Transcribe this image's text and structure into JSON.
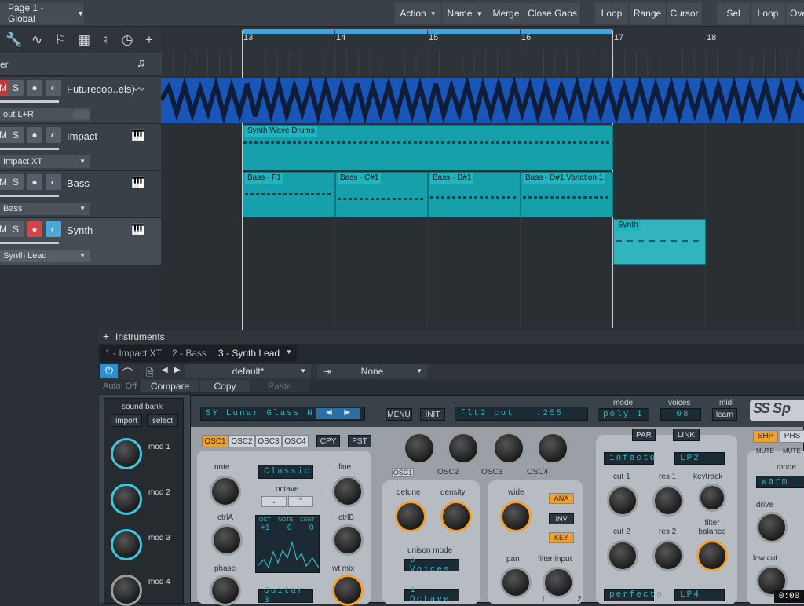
{
  "toolbar": {
    "page": "Page 1 - Global",
    "action": "Action",
    "name": "Name",
    "merge": "Merge",
    "close_gaps": "Close Gaps",
    "loop": "Loop",
    "range": "Range",
    "cursor": "Cursor",
    "sel": "Sel",
    "loop2": "Loop",
    "ove": "Ove"
  },
  "ruler": {
    "marks": [
      "13",
      "14",
      "15",
      "16",
      "17",
      "18"
    ]
  },
  "tracks": [
    {
      "label": "Futurecop..els)",
      "output": "out L+R",
      "m": "M",
      "s": "S"
    },
    {
      "label": "Impact",
      "output": "Impact XT",
      "m": "M",
      "s": "S"
    },
    {
      "label": "Bass",
      "output": "Bass",
      "m": "M",
      "s": "S"
    },
    {
      "label": "Synth",
      "output": "Synth Lead",
      "m": "M",
      "s": "S"
    }
  ],
  "header_label": "er",
  "clips": {
    "drums": "Synth Wave Drums",
    "bass1": "Bass - F1",
    "bass2": "Bass - C#1",
    "bass3": "Bass - D#1",
    "bass4": "Bass - D#1 Variation 1",
    "synth": "Synth"
  },
  "instruments": {
    "title": "Instruments",
    "tabs": [
      "1 - Impact XT",
      "2 - Bass",
      "3 - Synth Lead"
    ],
    "preset": "default*",
    "sidechain": "None",
    "auto": "Auto: Off",
    "compare": "Compare",
    "copy": "Copy",
    "paste": "Paste"
  },
  "synth": {
    "sound_bank": "sound bank",
    "import": "import",
    "select": "select",
    "mods": [
      "mod 1",
      "mod 2",
      "mod 3",
      "mod 4"
    ],
    "patch": "SY Lunar Glass N",
    "menu": "MENU",
    "init": "INIT",
    "param": "flt2 cut",
    "param_val": ":255",
    "mode_lbl": "mode",
    "mode": "poly 1",
    "voices_lbl": "voices",
    "voices": "08",
    "midi_lbl": "midi",
    "learn": "learn",
    "logo": "Sp",
    "osc_tabs": [
      "OSC1",
      "OSC2",
      "OSC3",
      "OSC4"
    ],
    "cpy": "CPY",
    "pst": "PST",
    "osc_sel": [
      "OSC1",
      "OSC2",
      "OSC3",
      "OSC4"
    ],
    "note": "note",
    "fine": "fine",
    "octave": "octave",
    "classic": "Classic",
    "ctrla": "ctrlA",
    "ctrlb": "ctrlB",
    "phase": "phase",
    "wtmix": "wt mix",
    "oct": "OCT",
    "note2": "NOTE",
    "cent": "CENT",
    "oct_v": "+1",
    "note_v": "0",
    "cent_v": "0",
    "guitar": "Guitar 3",
    "detune": "detune",
    "density": "density",
    "unison": "unison mode",
    "voices6": "6 Voices",
    "octave1": "1 Octave",
    "wide": "wide",
    "ana": "ANA",
    "inv": "INV",
    "key": "KEY",
    "pan": "pan",
    "filter_input": "filter input",
    "par": "PAR",
    "link": "LINK",
    "f1": "infecto",
    "f2": "LP2",
    "cut1": "cut 1",
    "res1": "res 1",
    "keytrack": "keytrack",
    "cut2": "cut 2",
    "res2": "res 2",
    "fbal": "filter balance",
    "perfecto": "perfecto",
    "lp4": "LP4",
    "shp": "SHP",
    "phs": "PHS",
    "mute": "MUTE",
    "mode2": "mode",
    "warm": "warm",
    "drive": "drive",
    "lowcut": "low cut",
    "fi1": "1",
    "fi2": "2"
  },
  "time": "0:00"
}
